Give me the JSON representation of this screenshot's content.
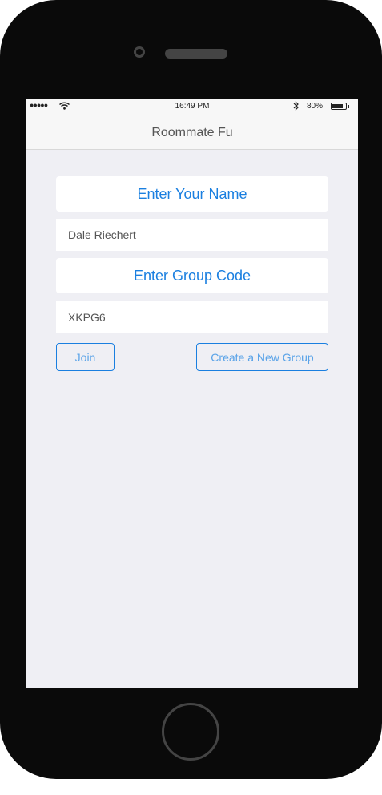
{
  "status_bar": {
    "signal": "●●●●●",
    "time": "16:49 PM",
    "battery_pct": "80%",
    "battery_level": 0.8
  },
  "navbar": {
    "title": "Roommate Fu"
  },
  "form": {
    "name_label": "Enter Your Name",
    "name_value": "Dale Riechert",
    "group_label": "Enter Group Code",
    "group_value": "XKPG6",
    "join_label": "Join",
    "create_label": "Create a New Group"
  },
  "colors": {
    "accent": "#1a7fe0",
    "background": "#efeff4",
    "device": "#0a0a0a"
  }
}
